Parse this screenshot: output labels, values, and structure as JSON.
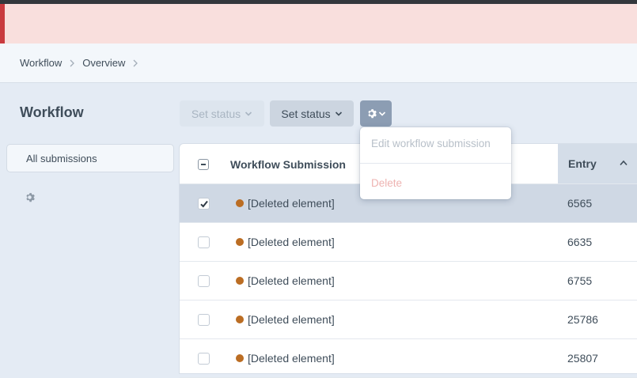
{
  "breadcrumbs": [
    {
      "label": "Workflow"
    },
    {
      "label": "Overview"
    }
  ],
  "page": {
    "title": "Workflow"
  },
  "toolbar": {
    "set_status_disabled_label": "Set status",
    "set_status_label": "Set status",
    "actions_icon": "gear-icon"
  },
  "sidebar": {
    "items": [
      {
        "label": "All submissions"
      }
    ],
    "settings_icon": "gear-icon"
  },
  "table": {
    "columns": {
      "title": "Workflow Submission",
      "entry": "Entry"
    },
    "sort": {
      "column": "Entry",
      "direction": "ascending"
    },
    "rows": [
      {
        "title": "[Deleted element]",
        "entry": "6565",
        "selected": true
      },
      {
        "title": "[Deleted element]",
        "entry": "6635",
        "selected": false
      },
      {
        "title": "[Deleted element]",
        "entry": "6755",
        "selected": false
      },
      {
        "title": "[Deleted element]",
        "entry": "25786",
        "selected": false
      },
      {
        "title": "[Deleted element]",
        "entry": "25807",
        "selected": false
      }
    ],
    "status_color": "#bb6d23"
  },
  "dropdown": {
    "edit_label": "Edit workflow submission",
    "delete_label": "Delete"
  },
  "colors": {
    "alert_bg": "#f9dfdd",
    "alert_border": "#c93a3e",
    "selected_row": "#cfd8e4",
    "gear_button": "#8c9db3"
  }
}
